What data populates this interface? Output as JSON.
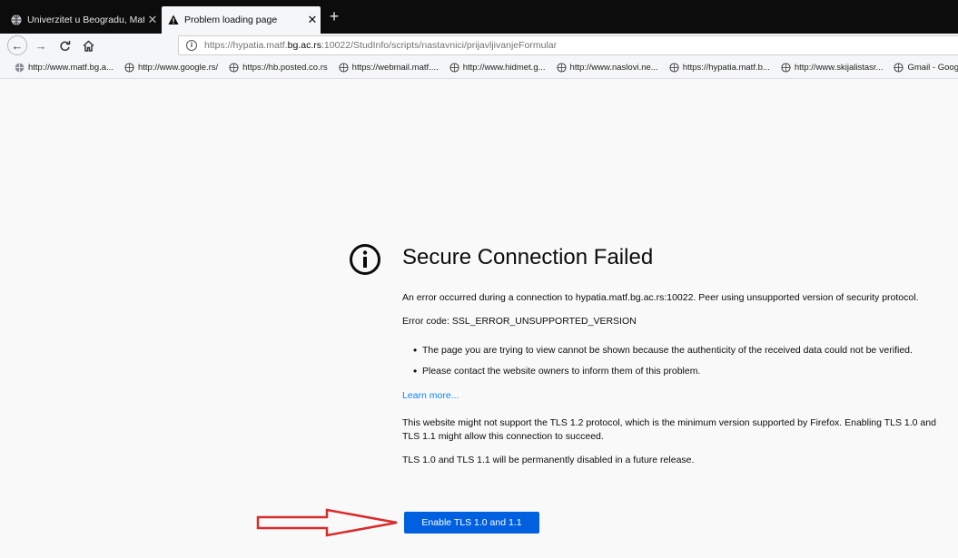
{
  "tabs": [
    {
      "title": "Univerzitet u Beogradu, Matem",
      "active": false
    },
    {
      "title": "Problem loading page",
      "active": true
    }
  ],
  "navbar": {
    "url_prefix": "https://hypatia.matf.",
    "url_host": "bg.ac.rs",
    "url_suffix": ":10022/StudInfo/scripts/nastavnici/prijavljivanjeFormular"
  },
  "bookmarks": [
    "http://www.matf.bg.a...",
    "http://www.google.rs/",
    "https://hb.posted.co.rs",
    "https://webmail.matf....",
    "http://www.hidmet.g...",
    "http://www.naslovi.ne...",
    "https://hypatia.matf.b...",
    "http://www.skijalistasr...",
    "Gmail - Google"
  ],
  "error": {
    "title": "Secure Connection Failed",
    "description": "An error occurred during a connection to hypatia.matf.bg.ac.rs:10022. Peer using unsupported version of security protocol.",
    "code": "Error code: SSL_ERROR_UNSUPPORTED_VERSION",
    "bullets": [
      "The page you are trying to view cannot be shown because the authenticity of the received data could not be verified.",
      "Please contact the website owners to inform them of this problem."
    ],
    "learn_more": "Learn more...",
    "tls_note": "This website might not support the TLS 1.2 protocol, which is the minimum version supported by Firefox. Enabling TLS 1.0 and TLS 1.1 might allow this connection to succeed.",
    "tls_disable_note": "TLS 1.0 and TLS 1.1 will be permanently disabled in a future release.",
    "button_label": "Enable TLS 1.0 and 1.1"
  },
  "colors": {
    "button": "#0060df",
    "link": "#0a84ff",
    "annotation_arrow": "#d92b2b"
  },
  "icons": [
    "globe-icon",
    "warning-icon",
    "back-arrow-icon",
    "forward-arrow-icon",
    "reload-icon",
    "home-icon",
    "info-icon",
    "error-info-icon",
    "red-arrow-annotation"
  ]
}
